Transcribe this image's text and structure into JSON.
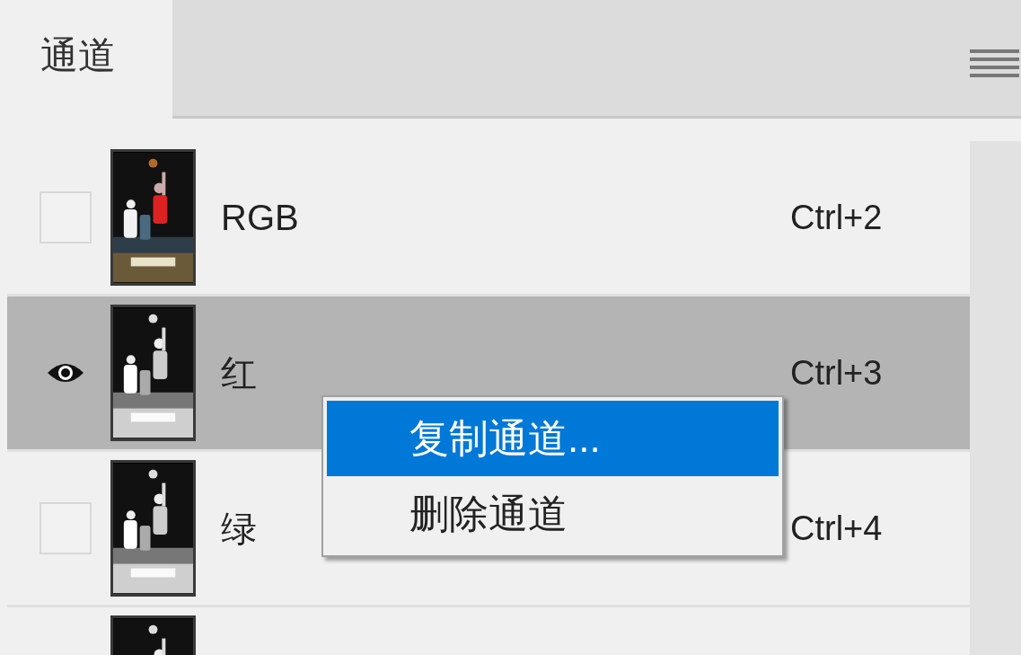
{
  "panel": {
    "tab": {
      "label": "通道",
      "selected": true
    }
  },
  "rows": [
    {
      "name": "RGB",
      "shortcut": "Ctrl+2",
      "visible": false,
      "selected": false
    },
    {
      "name": "红",
      "shortcut": "Ctrl+3",
      "visible": true,
      "selected": true
    },
    {
      "name": "绿",
      "shortcut": "Ctrl+4",
      "visible": false,
      "selected": false
    },
    {
      "selected": false
    }
  ],
  "context_menu": {
    "items": [
      {
        "label": "复制通道...",
        "selected": true
      },
      {
        "label": "删除通道",
        "selected": false
      }
    ]
  }
}
